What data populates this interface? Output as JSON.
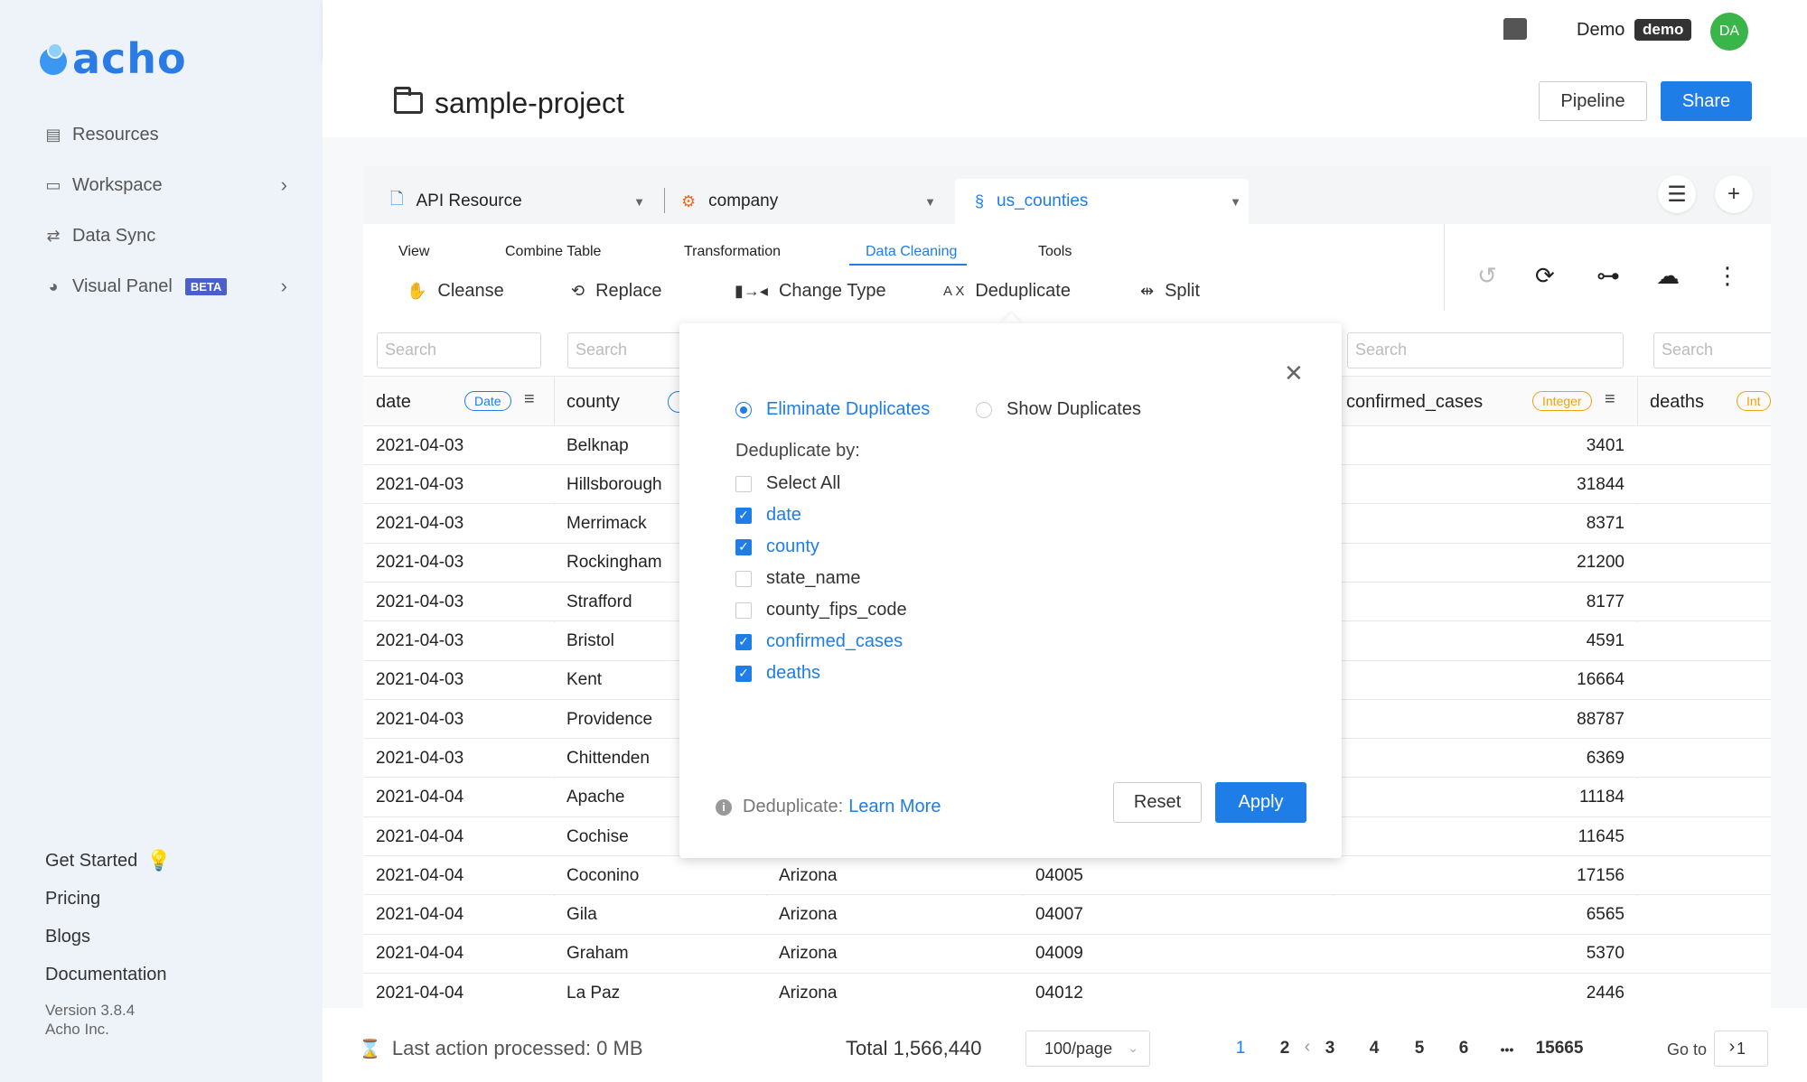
{
  "app": {
    "logo_text": "acho"
  },
  "sidebar": {
    "items": [
      {
        "label": "Resources"
      },
      {
        "label": "Workspace"
      },
      {
        "label": "Data Sync"
      },
      {
        "label": "Visual Panel",
        "badge": "BETA"
      }
    ],
    "bottom_links": [
      "Get Started",
      "Pricing",
      "Blogs",
      "Documentation"
    ],
    "version": "Version 3.8.4",
    "company": "Acho Inc."
  },
  "topbar": {
    "user_name": "Demo",
    "user_badge": "demo",
    "avatar_initials": "DA"
  },
  "project": {
    "title": "sample-project",
    "pipeline_label": "Pipeline",
    "share_label": "Share"
  },
  "resource_tabs": [
    {
      "label": "API Resource"
    },
    {
      "label": "company"
    },
    {
      "label": "us_counties"
    }
  ],
  "menus": [
    "View",
    "Combine Table",
    "Transformation",
    "Data Cleaning",
    "Tools"
  ],
  "tools": [
    "Cleanse",
    "Replace",
    "Change Type",
    "Deduplicate",
    "Split"
  ],
  "table": {
    "search_placeholder": "Search",
    "columns": [
      {
        "name": "date",
        "type": "Date"
      },
      {
        "name": "county",
        "type": ""
      },
      {
        "name": "state_name",
        "type": ""
      },
      {
        "name": "county_fips_code",
        "type": ""
      },
      {
        "name": "confirmed_cases",
        "type": "Integer"
      },
      {
        "name": "deaths",
        "type": "Int"
      }
    ],
    "rows": [
      [
        "2021-04-03",
        "Belknap",
        "",
        "",
        "3401"
      ],
      [
        "2021-04-03",
        "Hillsborough",
        "",
        "",
        "31844"
      ],
      [
        "2021-04-03",
        "Merrimack",
        "",
        "",
        "8371"
      ],
      [
        "2021-04-03",
        "Rockingham",
        "",
        "",
        "21200"
      ],
      [
        "2021-04-03",
        "Strafford",
        "",
        "",
        "8177"
      ],
      [
        "2021-04-03",
        "Bristol",
        "",
        "",
        "4591"
      ],
      [
        "2021-04-03",
        "Kent",
        "",
        "",
        "16664"
      ],
      [
        "2021-04-03",
        "Providence",
        "",
        "",
        "88787"
      ],
      [
        "2021-04-03",
        "Chittenden",
        "",
        "",
        "6369"
      ],
      [
        "2021-04-04",
        "Apache",
        "",
        "",
        "11184"
      ],
      [
        "2021-04-04",
        "Cochise",
        "",
        "",
        "11645"
      ],
      [
        "2021-04-04",
        "Coconino",
        "Arizona",
        "04005",
        "17156"
      ],
      [
        "2021-04-04",
        "Gila",
        "Arizona",
        "04007",
        "6565"
      ],
      [
        "2021-04-04",
        "Graham",
        "Arizona",
        "04009",
        "5370"
      ],
      [
        "2021-04-04",
        "La Paz",
        "Arizona",
        "04012",
        "2446"
      ]
    ]
  },
  "dedup": {
    "eliminate_label": "Eliminate Duplicates",
    "show_label": "Show Duplicates",
    "by_label": "Deduplicate by:",
    "options": [
      {
        "label": "Select All",
        "checked": false
      },
      {
        "label": "date",
        "checked": true
      },
      {
        "label": "county",
        "checked": true
      },
      {
        "label": "state_name",
        "checked": false
      },
      {
        "label": "county_fips_code",
        "checked": false
      },
      {
        "label": "confirmed_cases",
        "checked": true
      },
      {
        "label": "deaths",
        "checked": true
      }
    ],
    "info_label": "Deduplicate:",
    "learn_more": "Learn More",
    "reset_label": "Reset",
    "apply_label": "Apply"
  },
  "footer": {
    "last_action_label": "Last action processed:",
    "last_action_value": "0 MB",
    "total": "Total 1,566,440",
    "page_size": "100/page",
    "pages": [
      "1",
      "2",
      "3",
      "4",
      "5",
      "6",
      "•••",
      "15665"
    ],
    "current_page": "1",
    "goto_label": "Go to",
    "goto_value": "1"
  },
  "colors": {
    "accent": "#1f7de8",
    "sidebar_bg": "#eef2f9",
    "date_type": "#1f7de8",
    "int_type": "#f0a20a"
  }
}
